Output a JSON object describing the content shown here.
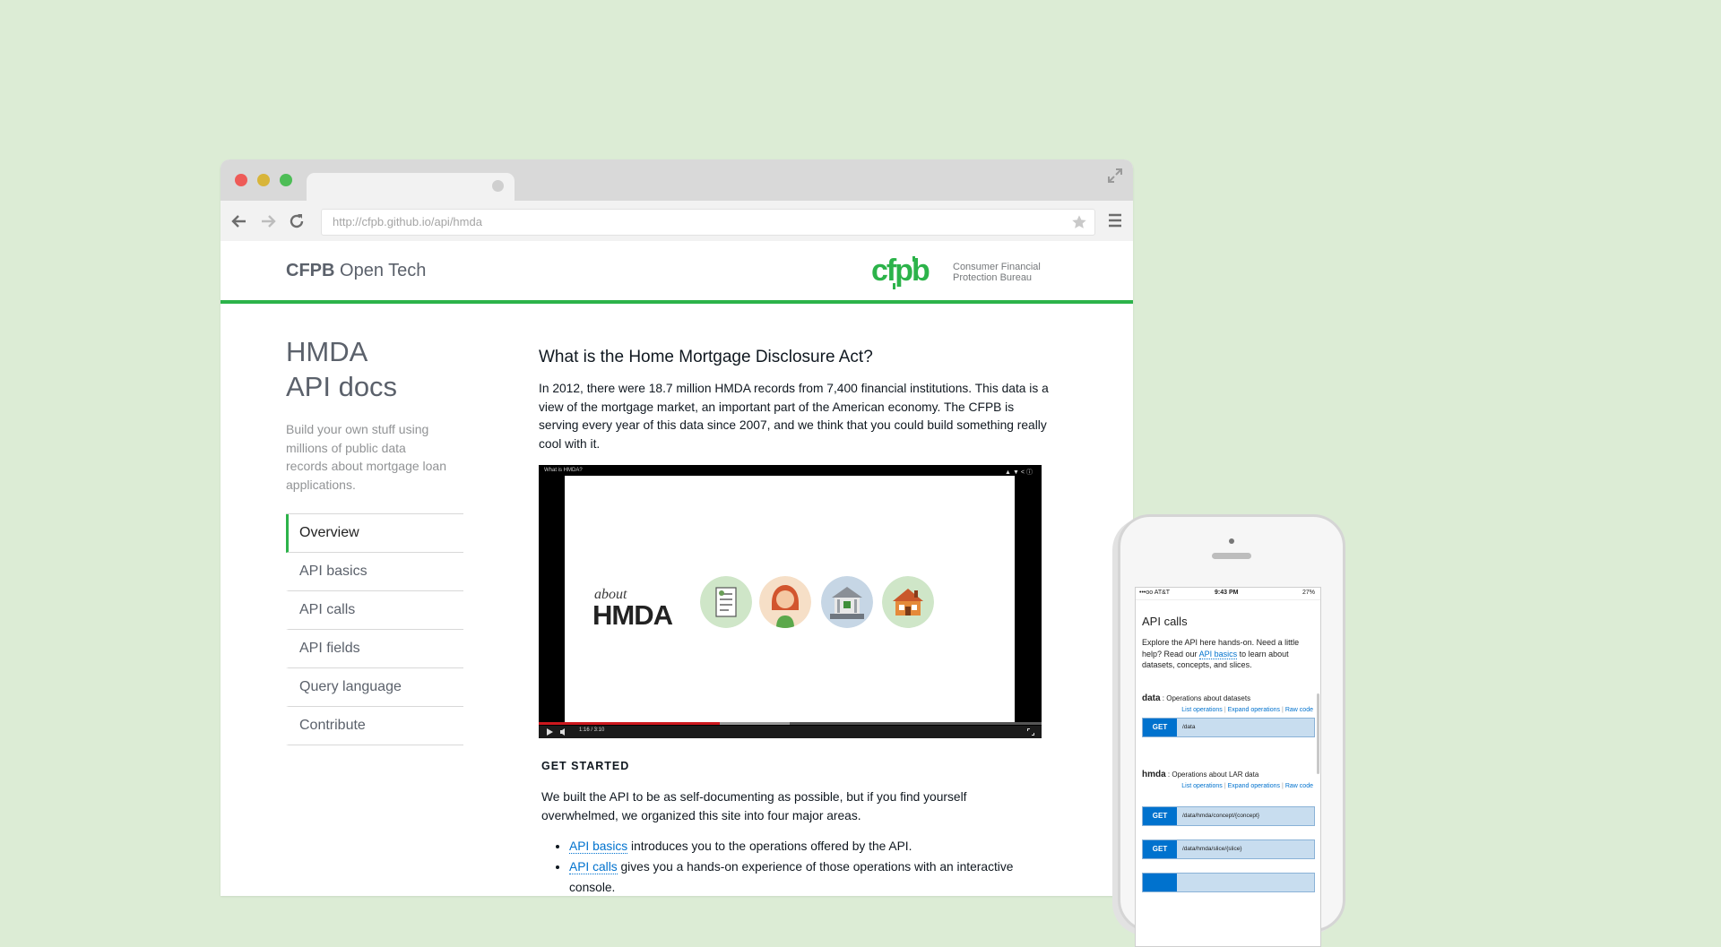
{
  "browser": {
    "url": "http://cfpb.github.io/api/hmda"
  },
  "site": {
    "brand_bold": "CFPB",
    "brand_rest": " Open Tech",
    "bureau_line1": "Consumer Financial",
    "bureau_line2": "Protection Bureau"
  },
  "sidebar": {
    "title_line1": "HMDA",
    "title_line2": "API docs",
    "tagline": "Build your own stuff using millions of public data records about mortgage loan applications.",
    "items": [
      {
        "label": "Overview"
      },
      {
        "label": "API basics"
      },
      {
        "label": "API calls"
      },
      {
        "label": "API fields"
      },
      {
        "label": "Query language"
      },
      {
        "label": "Contribute"
      }
    ]
  },
  "main": {
    "heading": "What is the Home Mortgage Disclosure Act?",
    "intro": "In 2012, there were 18.7 million HMDA records from 7,400 financial institutions. This data is a view of the mortgage market, an important part of the American economy. The CFPB is serving every year of this data since 2007, and we think that you could build something really cool with it.",
    "video": {
      "title": "What is HMDA?",
      "about": "about",
      "logo": "HMDA",
      "time": "1:16 / 3:10",
      "progress": 0.36
    },
    "get_started": "GET STARTED",
    "gs_text": "We built the API to be as self-documenting as possible, but if you find yourself overwhelmed, we organized this site into four major areas.",
    "list": [
      {
        "link": "API basics",
        "text": " introduces you to the operations offered by the API."
      },
      {
        "link": "API calls",
        "text": " gives you a hands-on experience of those operations with an interactive console."
      }
    ]
  },
  "phone": {
    "carrier": "•••oo AT&T",
    "time": "9:43 PM",
    "battery": "27%",
    "heading": "API calls",
    "intro_a": "Explore the API here hands-on. Need a little help? Read our ",
    "intro_link": "API basics",
    "intro_b": " to learn about datasets, concepts, and slices.",
    "sections": [
      {
        "name": "data",
        "desc": " : Operations about datasets",
        "links": [
          "List operations",
          "Expand operations",
          "Raw code"
        ]
      },
      {
        "name": "hmda",
        "desc": " : Operations about LAR data",
        "links": [
          "List operations",
          "Expand operations",
          "Raw code"
        ]
      }
    ],
    "rows": [
      {
        "method": "GET",
        "path": "/data"
      },
      {
        "method": "GET",
        "path": "/data/hmda/concept/{concept}"
      },
      {
        "method": "GET",
        "path": "/data/hmda/slice/{slice}"
      }
    ]
  },
  "colors": {
    "background": "#dcecd5",
    "accent_green": "#2cb34a",
    "link_blue": "#0072ce"
  }
}
